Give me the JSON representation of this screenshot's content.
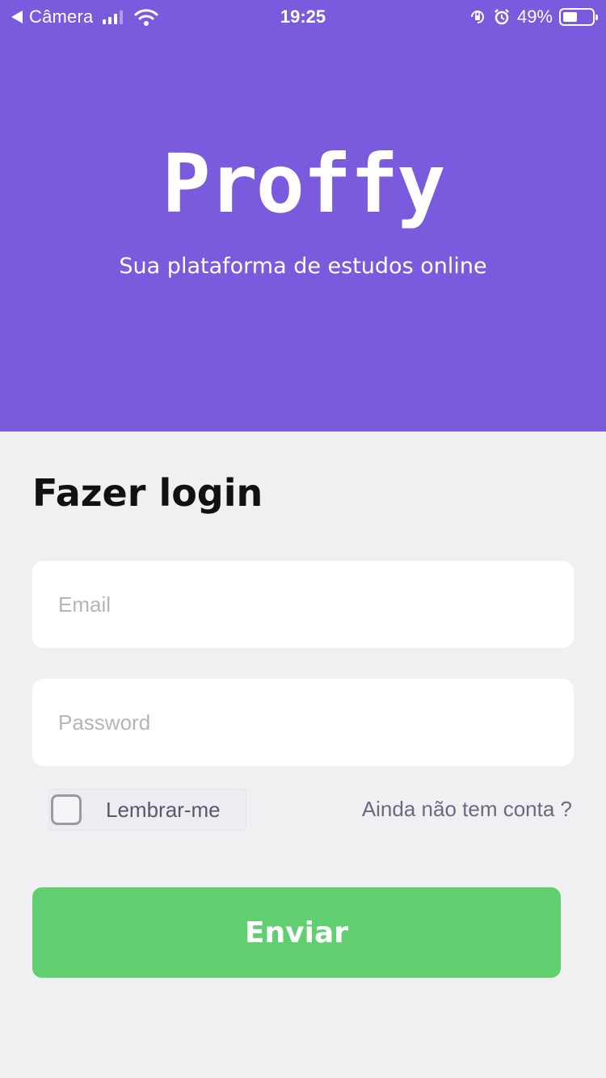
{
  "status_bar": {
    "carrier": "Câmera",
    "time": "19:25",
    "battery_percent": "49%",
    "battery_level": 0.49,
    "icons": [
      "back-arrow-icon",
      "signal-icon",
      "wifi-icon",
      "orientation-lock-icon",
      "alarm-icon",
      "battery-icon"
    ]
  },
  "hero": {
    "logo": "Proffy",
    "tagline": "Sua plataforma de estudos online",
    "background_color": "#7a5add"
  },
  "login": {
    "title": "Fazer login",
    "email_placeholder": "Email",
    "password_placeholder": "Password",
    "remember_label": "Lembrar-me",
    "signup_link": "Ainda não tem conta ?",
    "submit_label": "Enviar",
    "submit_color": "#5fcf70"
  }
}
